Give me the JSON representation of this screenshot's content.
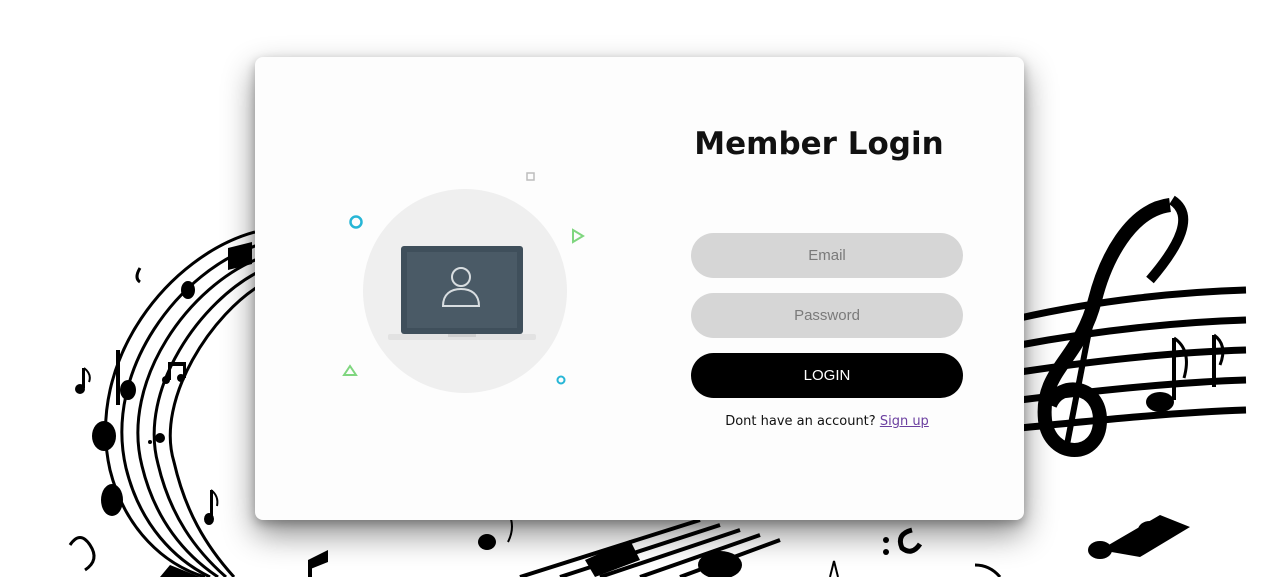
{
  "login": {
    "title": "Member Login",
    "email_placeholder": "Email",
    "password_placeholder": "Password",
    "button_label": "LOGIN",
    "signup_prompt": "Dont have an account?",
    "signup_link": "Sign up"
  },
  "icons": {
    "illustration": "laptop-user-icon",
    "background": "music-notes-decoration"
  },
  "colors": {
    "page_background": "#ffffff",
    "card_background": "#fdfdfd",
    "input_background": "#d6d6d6",
    "button_background": "#000000",
    "button_text": "#ffffff",
    "link": "#6b3fa0",
    "laptop_screen": "#3f4f5b",
    "accent_cyan": "#27b6d6",
    "accent_green": "#7fd67f"
  }
}
